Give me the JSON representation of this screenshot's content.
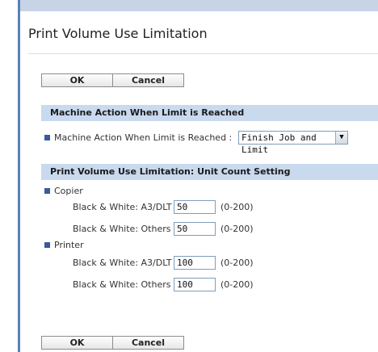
{
  "page": {
    "title": "Print Volume Use Limitation"
  },
  "buttons": {
    "ok": "OK",
    "cancel": "Cancel"
  },
  "machine_action": {
    "section_title": "Machine Action When Limit is Reached",
    "label": "Machine Action When Limit is Reached :",
    "selected": "Finish Job and Limit"
  },
  "unit_count": {
    "section_title": "Print Volume Use Limitation: Unit Count Setting",
    "copier": {
      "heading": "Copier",
      "rows": [
        {
          "label": "Black & White: A3/DLT :",
          "value": "50",
          "range": "(0-200)"
        },
        {
          "label": "Black & White: Others :",
          "value": "50",
          "range": "(0-200)"
        }
      ]
    },
    "printer": {
      "heading": "Printer",
      "rows": [
        {
          "label": "Black & White: A3/DLT :",
          "value": "100",
          "range": "(0-200)"
        },
        {
          "label": "Black & White: Others :",
          "value": "100",
          "range": "(0-200)"
        }
      ]
    }
  },
  "colors": {
    "section_bg": "#c9d9ee",
    "bullet": "#3a5a9c",
    "frame": "#5b7fb7"
  }
}
